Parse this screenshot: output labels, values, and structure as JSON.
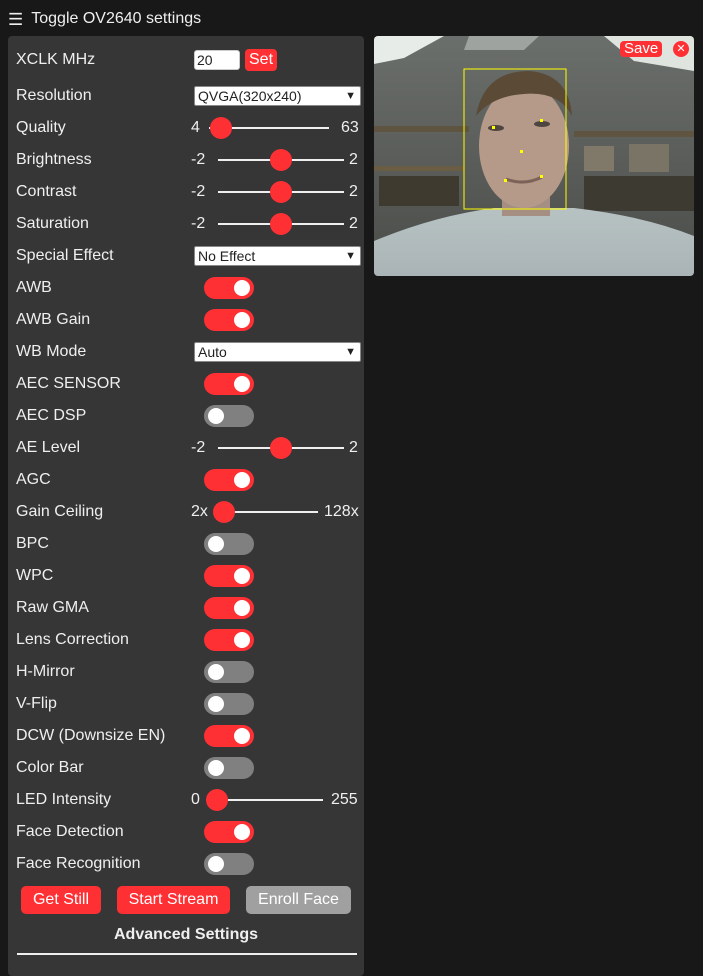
{
  "header": {
    "menu_icon": "hamburger-icon",
    "toggle_label": "Toggle OV2640 settings"
  },
  "accent_color": "#ff3034",
  "settings": {
    "xclk": {
      "label": "XCLK MHz",
      "value": "20",
      "set_label": "Set"
    },
    "resolution": {
      "label": "Resolution",
      "selected": "QVGA(320x240)"
    },
    "quality": {
      "label": "Quality",
      "min": "4",
      "max": "63",
      "value": 10
    },
    "brightness": {
      "label": "Brightness",
      "min": "-2",
      "max": "2",
      "value": 0
    },
    "contrast": {
      "label": "Contrast",
      "min": "-2",
      "max": "2",
      "value": 0
    },
    "saturation": {
      "label": "Saturation",
      "min": "-2",
      "max": "2",
      "value": 0
    },
    "special_effect": {
      "label": "Special Effect",
      "selected": "No Effect"
    },
    "awb": {
      "label": "AWB",
      "on": true
    },
    "awb_gain": {
      "label": "AWB Gain",
      "on": true
    },
    "wb_mode": {
      "label": "WB Mode",
      "selected": "Auto"
    },
    "aec_sensor": {
      "label": "AEC SENSOR",
      "on": true
    },
    "aec_dsp": {
      "label": "AEC DSP",
      "on": false
    },
    "ae_level": {
      "label": "AE Level",
      "min": "-2",
      "max": "2",
      "value": 0
    },
    "agc": {
      "label": "AGC",
      "on": true
    },
    "gain_ceiling": {
      "label": "Gain Ceiling",
      "min": "2x",
      "max": "128x",
      "value": 0
    },
    "bpc": {
      "label": "BPC",
      "on": false
    },
    "wpc": {
      "label": "WPC",
      "on": true
    },
    "raw_gma": {
      "label": "Raw GMA",
      "on": true
    },
    "lens_correction": {
      "label": "Lens Correction",
      "on": true
    },
    "h_mirror": {
      "label": "H-Mirror",
      "on": false
    },
    "v_flip": {
      "label": "V-Flip",
      "on": false
    },
    "dcw": {
      "label": "DCW (Downsize EN)",
      "on": true
    },
    "color_bar": {
      "label": "Color Bar",
      "on": false
    },
    "led_intensity": {
      "label": "LED Intensity",
      "min": "0",
      "max": "255",
      "value": 0
    },
    "face_detection": {
      "label": "Face Detection",
      "on": true
    },
    "face_recognition": {
      "label": "Face Recognition",
      "on": false
    }
  },
  "actions": {
    "get_still": "Get Still",
    "start_stream": "Start Stream",
    "enroll_face": "Enroll Face"
  },
  "advanced_title": "Advanced Settings",
  "preview": {
    "save_label": "Save",
    "close_icon": "close-icon"
  }
}
